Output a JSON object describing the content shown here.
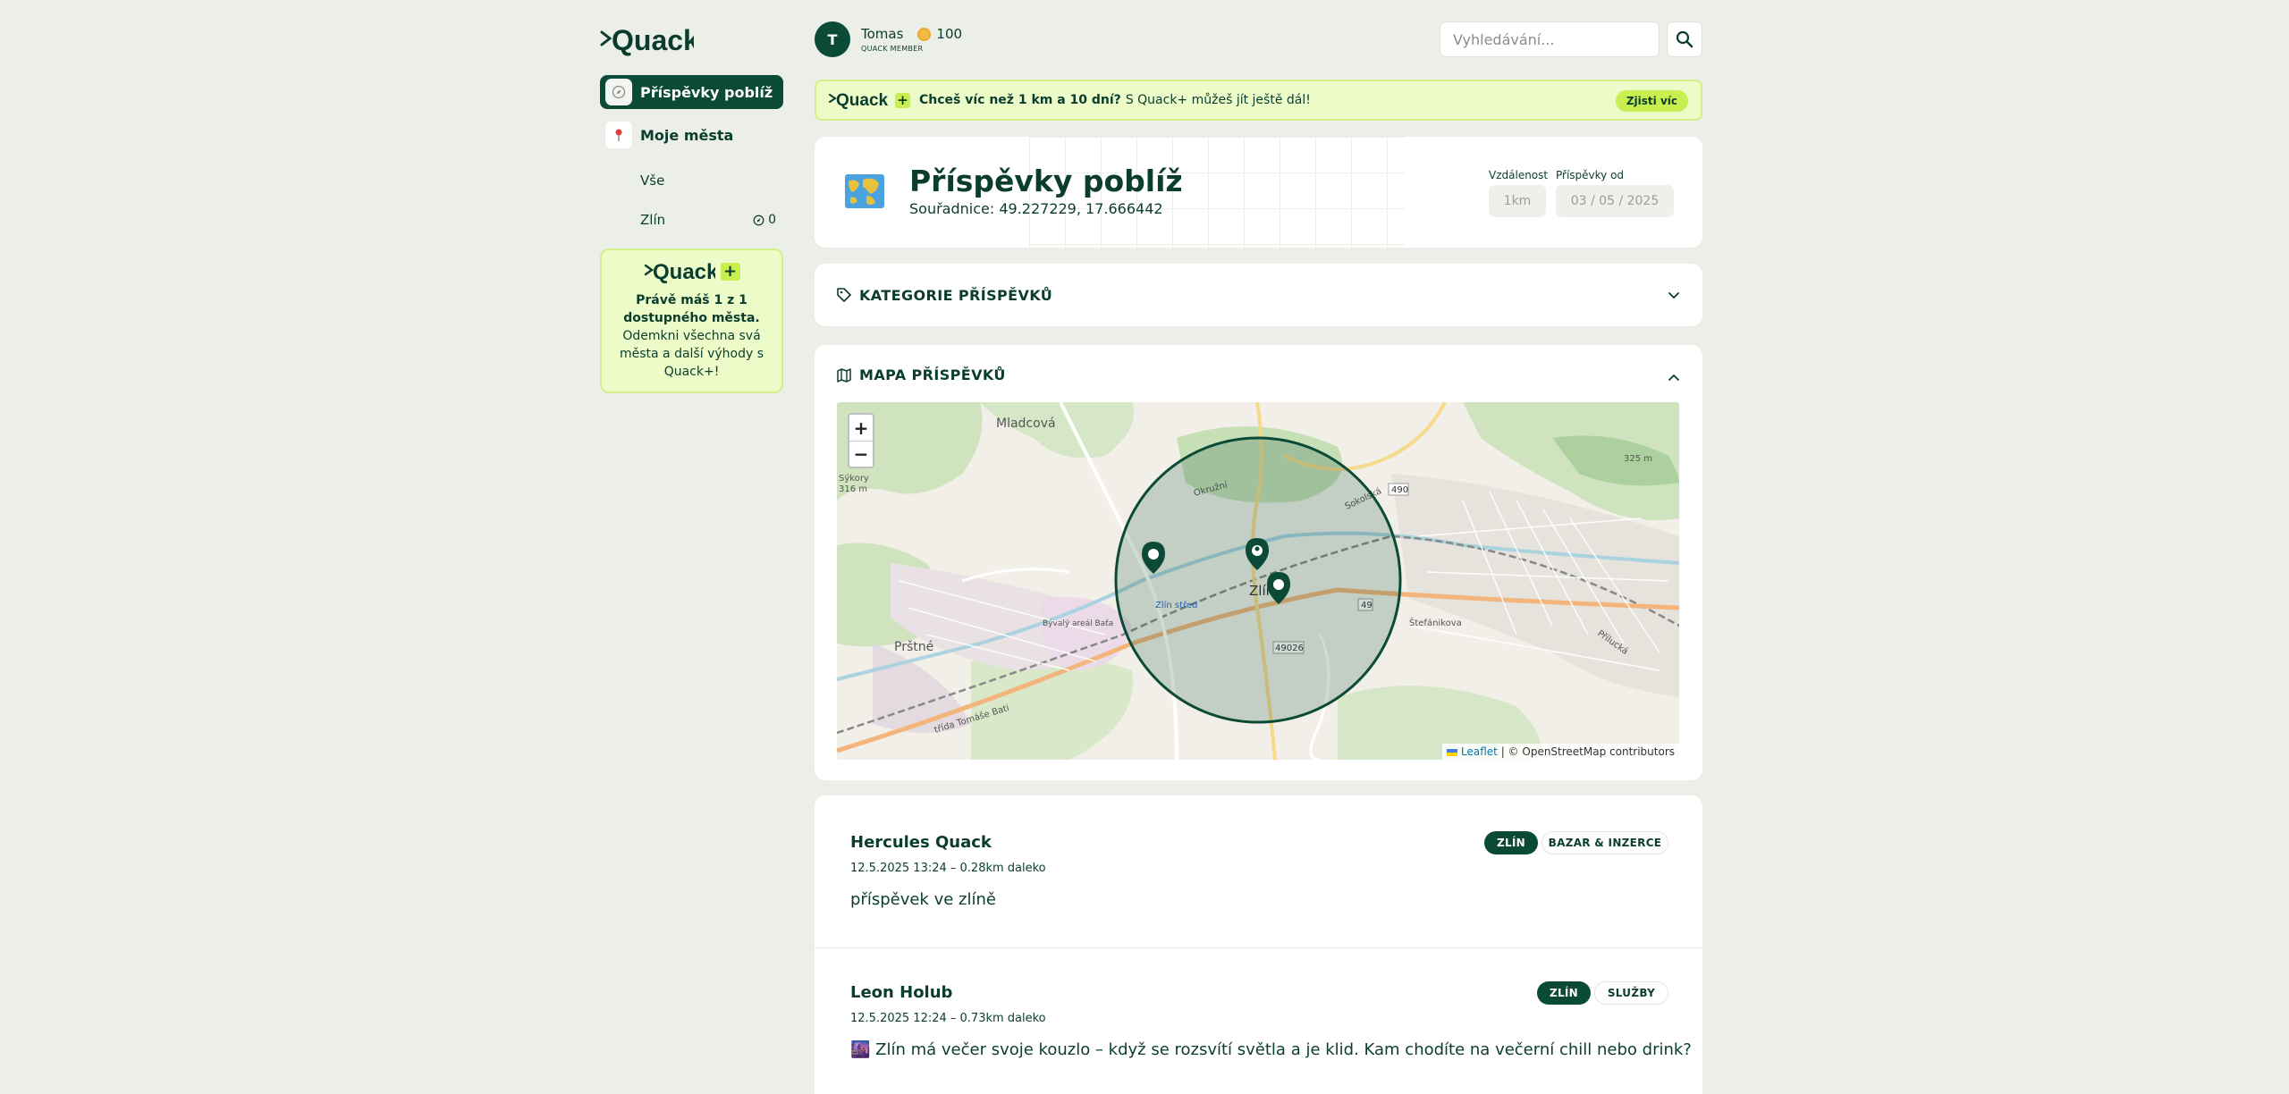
{
  "brand": {
    "name": "Quack",
    "plus": "+"
  },
  "sidebar": {
    "items": [
      {
        "label": "Příspěvky poblíž",
        "icon": "compass-icon",
        "active": true
      },
      {
        "label": "Moje města",
        "icon": "pin-icon",
        "active": false
      }
    ],
    "sub_items": [
      {
        "label": "Vše",
        "count": ""
      },
      {
        "label": "Zlín",
        "count": "0"
      }
    ],
    "promo": {
      "strong": "Právě máš 1 z 1 dostupného města.",
      "text": "Odemkni všechna svá města a další výhody s Quack+!"
    }
  },
  "user": {
    "initial": "T",
    "name": "Tomas",
    "coins": "100",
    "role": "QUACK MEMBER"
  },
  "search": {
    "placeholder": "Vyhledávání..."
  },
  "banner": {
    "strong": "Chceš víc než 1 km a 10 dní?",
    "text": "S Quack+ můžeš jít ještě dál!",
    "button": "Zjisti víc"
  },
  "header_card": {
    "title": "Příspěvky poblíž",
    "coords": "Souřadnice: 49.227229, 17.666442",
    "distance_label": "Vzdálenost",
    "distance_value": "1km",
    "date_label": "Příspěvky od",
    "date_value": "03 / 05 / 2025"
  },
  "categories": {
    "title": "KATEGORIE PŘÍSPĚVKŮ"
  },
  "map": {
    "title": "MAPA PŘÍSPĚVKŮ",
    "zoom_in": "+",
    "zoom_out": "−",
    "attribution_leaflet": "Leaflet",
    "attribution_rest": "| © OpenStreetMap contributors",
    "labels": {
      "mladcova": "Mladcová",
      "sykory": "Sýkory",
      "sykory_alt": "316 m",
      "prstne": "Prštné",
      "zlin": "Zlín",
      "zlin_stred": "Zlín střed",
      "stefanikova": "Štefánikova",
      "r49": "49",
      "r490": "490",
      "r49026": "49026",
      "alt325": "325 m",
      "bata": "Bývalý areál Baťa",
      "okruzni": "Okružní",
      "trida_bati": "třída Tomáše Bati",
      "prilucka": "Přílucká",
      "sokolska": "Sokolská"
    }
  },
  "posts": [
    {
      "author": "Hercules Quack",
      "meta": "12.5.2025 13:24 – 0.28km daleko",
      "text": "příspěvek ve zlíně",
      "city": "ZLÍN",
      "category": "BAZAR & INZERCE"
    },
    {
      "author": "Leon Holub",
      "meta": "12.5.2025 12:24 – 0.73km daleko",
      "text": "🌆 Zlín má večer svoje kouzlo – když se rozsvítí světla a je klid. Kam chodíte na večerní chill nebo drink?",
      "city": "ZLÍN",
      "category": "SLUŽBY"
    }
  ],
  "colors": {
    "primary": "#0b4a37",
    "accent": "#c8ee4f",
    "promo_bg": "#ecfbc8",
    "page_bg": "#eceee8"
  }
}
